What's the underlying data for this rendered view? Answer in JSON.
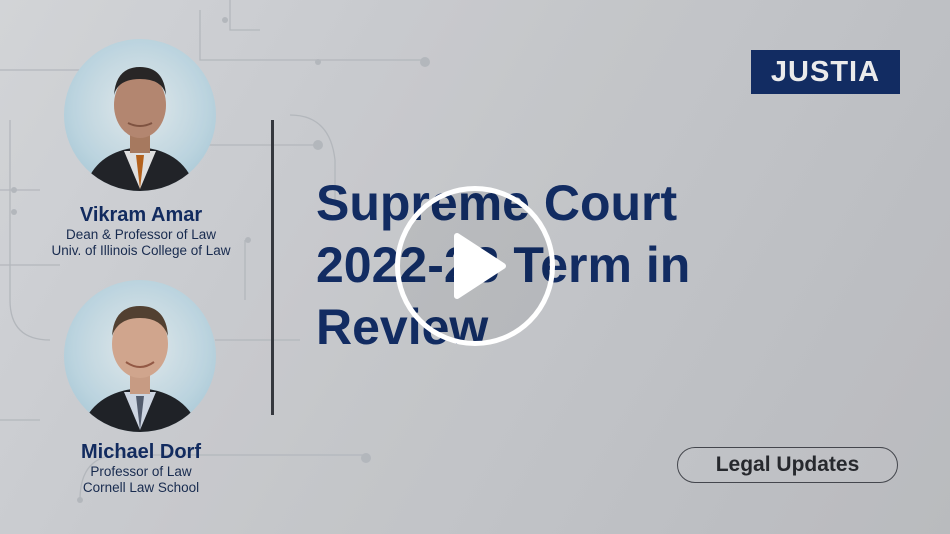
{
  "logo": {
    "text": "JUSTIA"
  },
  "title": "Supreme Court 2022-23 Term in Review",
  "speakers": [
    {
      "name": "Vikram Amar",
      "role_line1": "Dean & Professor of Law",
      "role_line2": "Univ. of Illinois College of Law"
    },
    {
      "name": "Michael Dorf",
      "role_line1": "Professor of Law",
      "role_line2": "Cornell Law School"
    }
  ],
  "badge": "Legal Updates",
  "icons": {
    "play": "play-icon"
  },
  "colors": {
    "brand_navy": "#14306b",
    "portrait_bg": "#cfe8f3",
    "divider": "#3a3d44"
  }
}
